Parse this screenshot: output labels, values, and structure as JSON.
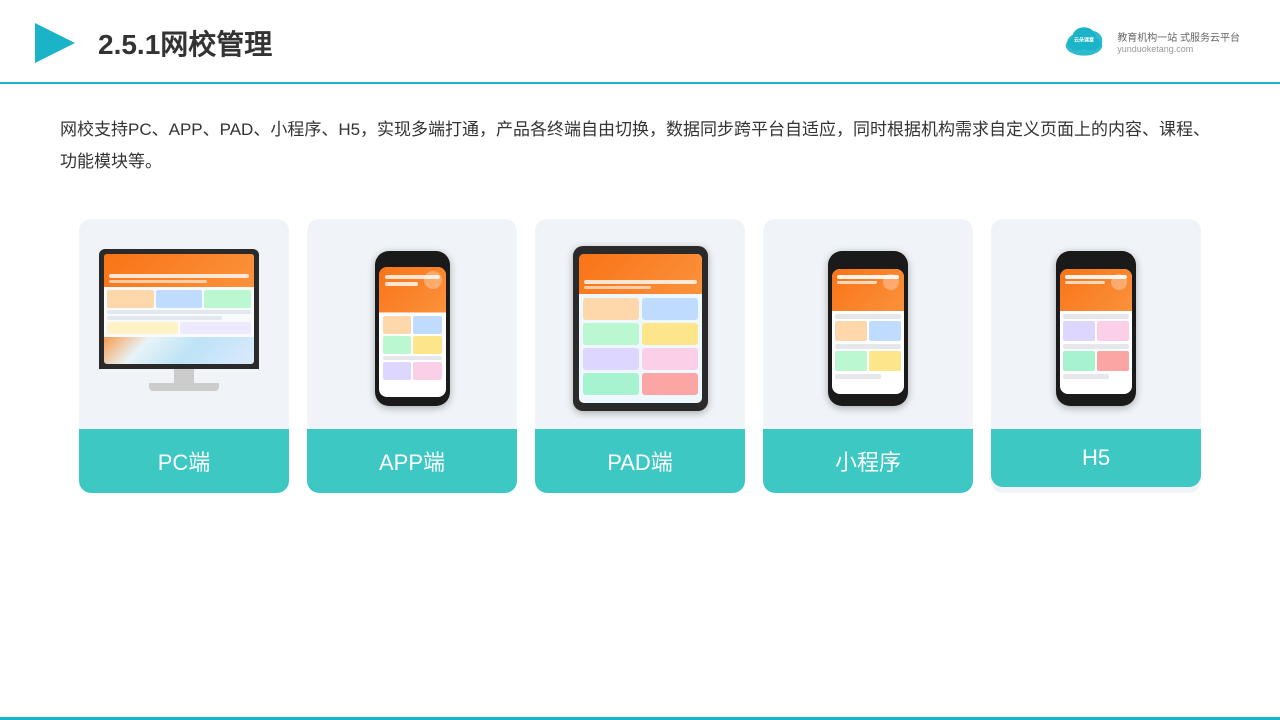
{
  "header": {
    "title": "2.5.1网校管理",
    "brand_name": "云朵课堂",
    "brand_url": "yunduoketang.com",
    "brand_tagline": "教育机构一站\n式服务云平台"
  },
  "description": {
    "text": "网校支持PC、APP、PAD、小程序、H5，实现多端打通，产品各终端自由切换，数据同步跨平台自适应，同时根据机构需求自定义页面上的内容、课程、功能模块等。"
  },
  "cards": [
    {
      "id": "pc",
      "label": "PC端"
    },
    {
      "id": "app",
      "label": "APP端"
    },
    {
      "id": "pad",
      "label": "PAD端"
    },
    {
      "id": "miniprogram",
      "label": "小程序"
    },
    {
      "id": "h5",
      "label": "H5"
    }
  ],
  "colors": {
    "teal": "#3dc8c4",
    "accent": "#1ab3c8",
    "orange": "#f97316"
  }
}
